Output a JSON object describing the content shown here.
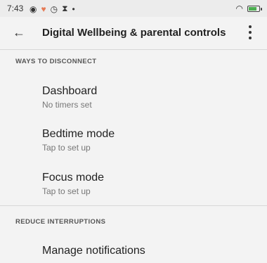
{
  "status_bar": {
    "time": "7:43"
  },
  "app_bar": {
    "title": "Digital Wellbeing & parental controls"
  },
  "sections": [
    {
      "header": "WAYS TO DISCONNECT",
      "items": [
        {
          "title": "Dashboard",
          "subtitle": "No timers set"
        },
        {
          "title": "Bedtime mode",
          "subtitle": "Tap to set up"
        },
        {
          "title": "Focus mode",
          "subtitle": "Tap to set up"
        }
      ]
    },
    {
      "header": "REDUCE INTERRUPTIONS",
      "items": [
        {
          "title": "Manage notifications"
        }
      ]
    }
  ]
}
